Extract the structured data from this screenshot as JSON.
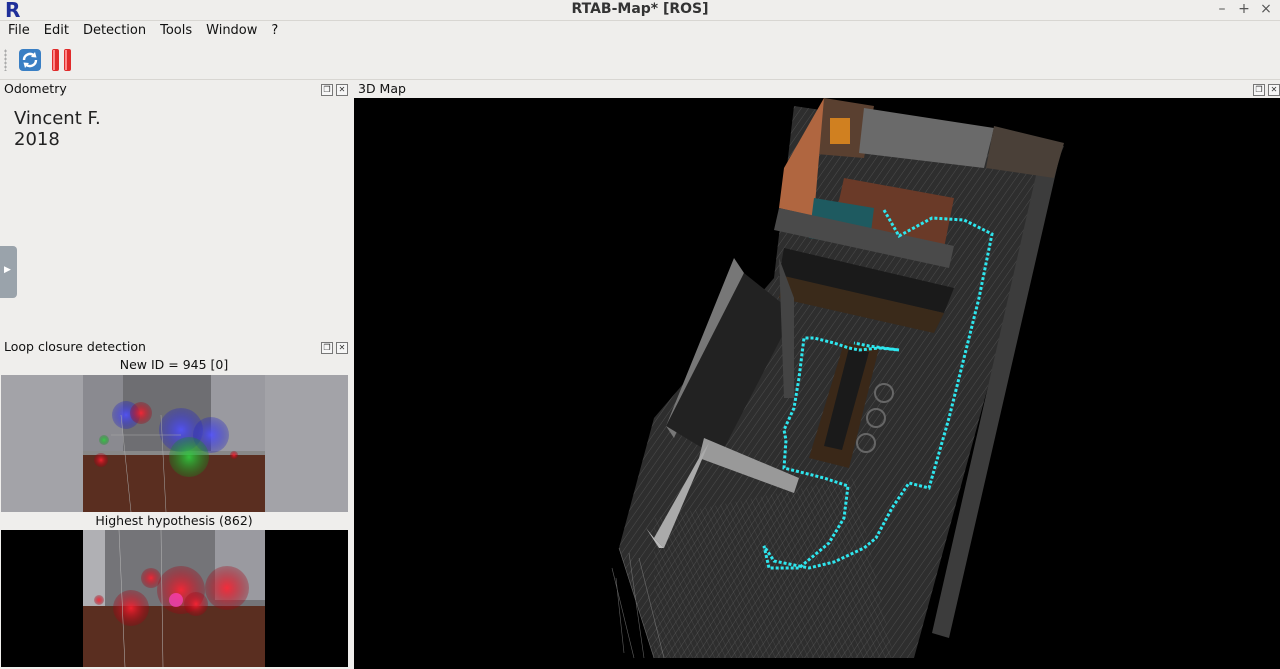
{
  "window": {
    "title": "RTAB-Map* [ROS]",
    "logo_letter": "R",
    "controls": {
      "minimize": "–",
      "maximize": "+",
      "close": "×"
    }
  },
  "menu": [
    "File",
    "Edit",
    "Detection",
    "Tools",
    "Window",
    "?"
  ],
  "toolbar": {
    "icons": [
      "refresh-icon",
      "pause-icon"
    ]
  },
  "odometry": {
    "title": "Odometry",
    "line1": "Vincent F.",
    "line2": "2018"
  },
  "loop_closure": {
    "title": "Loop closure detection",
    "new_id": "New ID = 945 [0]",
    "highest": "Highest hypothesis (862)"
  },
  "map3d": {
    "title": "3D Map"
  },
  "colors": {
    "trajectory": "#2ee6ee",
    "background": "#000000"
  }
}
